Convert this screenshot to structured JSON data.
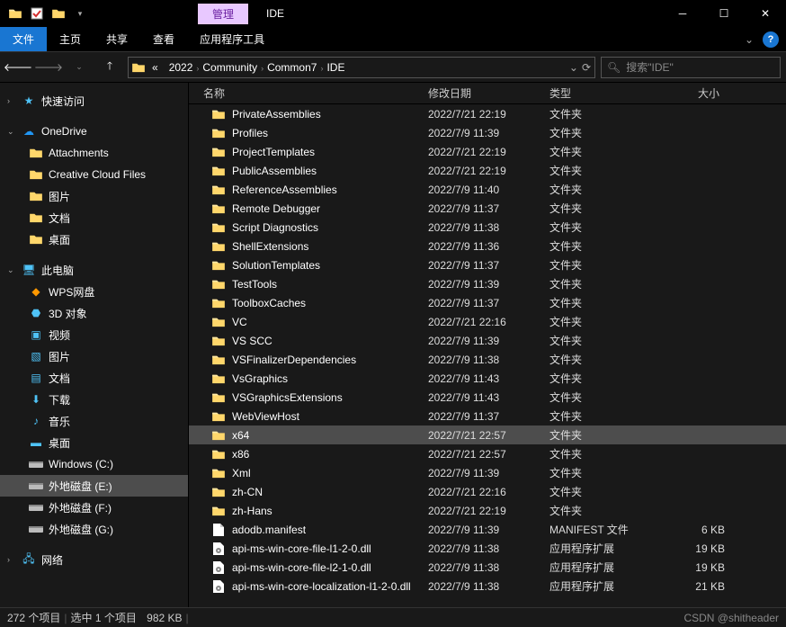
{
  "title": {
    "manage_tab": "管理",
    "text": "IDE"
  },
  "ribbon": {
    "file": "文件",
    "home": "主页",
    "share": "共享",
    "view": "查看",
    "app_tools": "应用程序工具"
  },
  "breadcrumb": {
    "prefix": "«",
    "parts": [
      "2022",
      "Community",
      "Common7",
      "IDE"
    ]
  },
  "search": {
    "placeholder": "搜索\"IDE\""
  },
  "nav": {
    "quick_access": "快速访问",
    "onedrive": "OneDrive",
    "onedrive_children": [
      "Attachments",
      "Creative Cloud Files",
      "图片",
      "文档",
      "桌面"
    ],
    "this_pc": "此电脑",
    "this_pc_children": [
      {
        "label": "WPS网盘",
        "icon": "wps"
      },
      {
        "label": "3D 对象",
        "icon": "3d"
      },
      {
        "label": "视频",
        "icon": "video"
      },
      {
        "label": "图片",
        "icon": "pic"
      },
      {
        "label": "文档",
        "icon": "doc"
      },
      {
        "label": "下载",
        "icon": "dl"
      },
      {
        "label": "音乐",
        "icon": "music"
      },
      {
        "label": "桌面",
        "icon": "desk"
      },
      {
        "label": "Windows (C:)",
        "icon": "drive"
      },
      {
        "label": "外地磁盘 (E:)",
        "icon": "drive",
        "selected": true
      },
      {
        "label": "外地磁盘 (F:)",
        "icon": "drive"
      },
      {
        "label": "外地磁盘 (G:)",
        "icon": "drive"
      }
    ],
    "network": "网络"
  },
  "columns": {
    "name": "名称",
    "date": "修改日期",
    "type": "类型",
    "size": "大小"
  },
  "files": [
    {
      "name": "PrivateAssemblies",
      "date": "2022/7/21 22:19",
      "type": "文件夹",
      "size": "",
      "icon": "folder"
    },
    {
      "name": "Profiles",
      "date": "2022/7/9 11:39",
      "type": "文件夹",
      "size": "",
      "icon": "folder"
    },
    {
      "name": "ProjectTemplates",
      "date": "2022/7/21 22:19",
      "type": "文件夹",
      "size": "",
      "icon": "folder"
    },
    {
      "name": "PublicAssemblies",
      "date": "2022/7/21 22:19",
      "type": "文件夹",
      "size": "",
      "icon": "folder"
    },
    {
      "name": "ReferenceAssemblies",
      "date": "2022/7/9 11:40",
      "type": "文件夹",
      "size": "",
      "icon": "folder"
    },
    {
      "name": "Remote Debugger",
      "date": "2022/7/9 11:37",
      "type": "文件夹",
      "size": "",
      "icon": "folder"
    },
    {
      "name": "Script Diagnostics",
      "date": "2022/7/9 11:38",
      "type": "文件夹",
      "size": "",
      "icon": "folder"
    },
    {
      "name": "ShellExtensions",
      "date": "2022/7/9 11:36",
      "type": "文件夹",
      "size": "",
      "icon": "folder"
    },
    {
      "name": "SolutionTemplates",
      "date": "2022/7/9 11:37",
      "type": "文件夹",
      "size": "",
      "icon": "folder"
    },
    {
      "name": "TestTools",
      "date": "2022/7/9 11:39",
      "type": "文件夹",
      "size": "",
      "icon": "folder"
    },
    {
      "name": "ToolboxCaches",
      "date": "2022/7/9 11:37",
      "type": "文件夹",
      "size": "",
      "icon": "folder"
    },
    {
      "name": "VC",
      "date": "2022/7/21 22:16",
      "type": "文件夹",
      "size": "",
      "icon": "folder"
    },
    {
      "name": "VS SCC",
      "date": "2022/7/9 11:39",
      "type": "文件夹",
      "size": "",
      "icon": "folder"
    },
    {
      "name": "VSFinalizerDependencies",
      "date": "2022/7/9 11:38",
      "type": "文件夹",
      "size": "",
      "icon": "folder"
    },
    {
      "name": "VsGraphics",
      "date": "2022/7/9 11:43",
      "type": "文件夹",
      "size": "",
      "icon": "folder"
    },
    {
      "name": "VSGraphicsExtensions",
      "date": "2022/7/9 11:43",
      "type": "文件夹",
      "size": "",
      "icon": "folder"
    },
    {
      "name": "WebViewHost",
      "date": "2022/7/9 11:37",
      "type": "文件夹",
      "size": "",
      "icon": "folder"
    },
    {
      "name": "x64",
      "date": "2022/7/21 22:57",
      "type": "文件夹",
      "size": "",
      "icon": "folder",
      "selected": true
    },
    {
      "name": "x86",
      "date": "2022/7/21 22:57",
      "type": "文件夹",
      "size": "",
      "icon": "folder"
    },
    {
      "name": "Xml",
      "date": "2022/7/9 11:39",
      "type": "文件夹",
      "size": "",
      "icon": "folder"
    },
    {
      "name": "zh-CN",
      "date": "2022/7/21 22:16",
      "type": "文件夹",
      "size": "",
      "icon": "folder"
    },
    {
      "name": "zh-Hans",
      "date": "2022/7/21 22:19",
      "type": "文件夹",
      "size": "",
      "icon": "folder"
    },
    {
      "name": "adodb.manifest",
      "date": "2022/7/9 11:39",
      "type": "MANIFEST 文件",
      "size": "6 KB",
      "icon": "file"
    },
    {
      "name": "api-ms-win-core-file-l1-2-0.dll",
      "date": "2022/7/9 11:38",
      "type": "应用程序扩展",
      "size": "19 KB",
      "icon": "dll"
    },
    {
      "name": "api-ms-win-core-file-l2-1-0.dll",
      "date": "2022/7/9 11:38",
      "type": "应用程序扩展",
      "size": "19 KB",
      "icon": "dll"
    },
    {
      "name": "api-ms-win-core-localization-l1-2-0.dll",
      "date": "2022/7/9 11:38",
      "type": "应用程序扩展",
      "size": "21 KB",
      "icon": "dll"
    }
  ],
  "status": {
    "count": "272 个项目",
    "selection": "选中 1 个项目",
    "size": "982 KB"
  },
  "watermark": "CSDN @shitheader"
}
